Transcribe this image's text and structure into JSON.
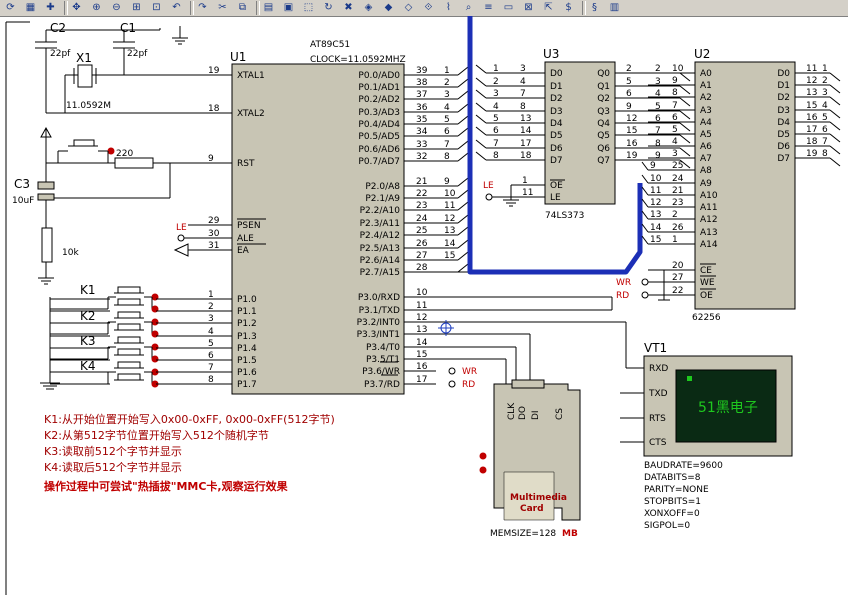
{
  "toolbar": {
    "icons": [
      "refresh-icon",
      "grid-icon",
      "origin-icon",
      "pan-icon",
      "zoom-in-icon",
      "zoom-out-icon",
      "zoom-fit-icon",
      "zoom-area-icon",
      "undo-icon",
      "redo-icon",
      "cut-icon",
      "copy-icon",
      "paste-icon",
      "block-copy-icon",
      "block-move-icon",
      "block-rotate-icon",
      "block-delete-icon",
      "pick-device-icon",
      "make-device-icon",
      "package-icon",
      "decompose-icon",
      "wire-autorouter-icon",
      "search-icon",
      "property-icon",
      "new-sheet-icon",
      "remove-sheet-icon",
      "exit-to-parent-icon",
      "bom-icon",
      "erc-icon",
      "netlist-icon"
    ]
  },
  "components": {
    "c2": {
      "ref": "C2",
      "value": "22pf"
    },
    "c1": {
      "ref": "C1",
      "value": "22pf"
    },
    "x1": {
      "ref": "X1",
      "value": "11.0592M"
    },
    "c3": {
      "ref": "C3",
      "value": "10uF"
    },
    "r_reset_series": {
      "value": "220"
    },
    "r_reset_pulldown": {
      "value": "10k"
    },
    "k1": "K1",
    "k2": "K2",
    "k3": "K3",
    "k4": "K4"
  },
  "u1": {
    "ref": "U1",
    "part": "AT89C51",
    "clock": "CLOCK=11.0592MHZ",
    "left_pins": [
      {
        "num": "19",
        "name": "XTAL1"
      },
      {
        "num": "18",
        "name": "XTAL2"
      },
      {
        "num": "9",
        "name": "RST"
      },
      {
        "num": "29",
        "name": "PSEN"
      },
      {
        "num": "30",
        "name": "ALE"
      },
      {
        "num": "31",
        "name": "EA"
      },
      {
        "num": "1",
        "name": "P1.0"
      },
      {
        "num": "2",
        "name": "P1.1"
      },
      {
        "num": "3",
        "name": "P1.2"
      },
      {
        "num": "4",
        "name": "P1.3"
      },
      {
        "num": "5",
        "name": "P1.4"
      },
      {
        "num": "6",
        "name": "P1.5"
      },
      {
        "num": "7",
        "name": "P1.6"
      },
      {
        "num": "8",
        "name": "P1.7"
      }
    ],
    "right_pins": [
      {
        "num": "39",
        "name": "P0.0/AD0",
        "net": "1"
      },
      {
        "num": "38",
        "name": "P0.1/AD1",
        "net": "2"
      },
      {
        "num": "37",
        "name": "P0.2/AD2",
        "net": "3"
      },
      {
        "num": "36",
        "name": "P0.3/AD3",
        "net": "4"
      },
      {
        "num": "35",
        "name": "P0.4/AD4",
        "net": "5"
      },
      {
        "num": "34",
        "name": "P0.5/AD5",
        "net": "6"
      },
      {
        "num": "33",
        "name": "P0.6/AD6",
        "net": "7"
      },
      {
        "num": "32",
        "name": "P0.7/AD7",
        "net": "8"
      },
      {
        "num": "21",
        "name": "P2.0/A8",
        "net": "9"
      },
      {
        "num": "22",
        "name": "P2.1/A9",
        "net": "10"
      },
      {
        "num": "23",
        "name": "P2.2/A10",
        "net": "11"
      },
      {
        "num": "24",
        "name": "P2.3/A11",
        "net": "12"
      },
      {
        "num": "25",
        "name": "P2.4/A12",
        "net": "13"
      },
      {
        "num": "26",
        "name": "P2.5/A13",
        "net": "14"
      },
      {
        "num": "27",
        "name": "P2.6/A14",
        "net": "15"
      },
      {
        "num": "28",
        "name": "P2.7/A15",
        "net": ""
      },
      {
        "num": "10",
        "name": "P3.0/RXD",
        "net": ""
      },
      {
        "num": "11",
        "name": "P3.1/TXD",
        "net": ""
      },
      {
        "num": "12",
        "name": "P3.2/INT0",
        "net": ""
      },
      {
        "num": "13",
        "name": "P3.3/INT1",
        "net": ""
      },
      {
        "num": "14",
        "name": "P3.4/T0",
        "net": ""
      },
      {
        "num": "15",
        "name": "P3.5/T1",
        "net": ""
      },
      {
        "num": "16",
        "name": "P3.6/WR",
        "net": "WR"
      },
      {
        "num": "17",
        "name": "P3.7/RD",
        "net": "RD"
      }
    ],
    "le_label": "LE"
  },
  "u3": {
    "ref": "U3",
    "part": "74LS373",
    "d_pins": [
      {
        "num": "3",
        "name": "D0"
      },
      {
        "num": "4",
        "name": "D1"
      },
      {
        "num": "7",
        "name": "D2"
      },
      {
        "num": "8",
        "name": "D3"
      },
      {
        "num": "13",
        "name": "D4"
      },
      {
        "num": "14",
        "name": "D5"
      },
      {
        "num": "17",
        "name": "D6"
      },
      {
        "num": "18",
        "name": "D7"
      }
    ],
    "q_pins": [
      {
        "num": "2",
        "name": "Q0"
      },
      {
        "num": "5",
        "name": "Q1"
      },
      {
        "num": "6",
        "name": "Q2"
      },
      {
        "num": "9",
        "name": "Q3"
      },
      {
        "num": "12",
        "name": "Q4"
      },
      {
        "num": "15",
        "name": "Q5"
      },
      {
        "num": "16",
        "name": "Q6"
      },
      {
        "num": "19",
        "name": "Q7"
      }
    ],
    "d_nets": [
      "1",
      "2",
      "3",
      "4",
      "5",
      "6",
      "7",
      "8"
    ],
    "q_nets": [
      "2",
      "3",
      "4",
      "5",
      "6",
      "7",
      "8",
      "9"
    ],
    "oe": {
      "num": "1",
      "name": "OE"
    },
    "le": {
      "num": "11",
      "name": "LE"
    },
    "le_label": "LE"
  },
  "u2": {
    "ref": "U2",
    "part": "62256",
    "a_pins": [
      {
        "num": "10",
        "name": "A0",
        "net": "2"
      },
      {
        "num": "9",
        "name": "A1",
        "net": "3"
      },
      {
        "num": "8",
        "name": "A2",
        "net": "4"
      },
      {
        "num": "7",
        "name": "A3",
        "net": "5"
      },
      {
        "num": "6",
        "name": "A4",
        "net": "6"
      },
      {
        "num": "5",
        "name": "A5",
        "net": "7"
      },
      {
        "num": "4",
        "name": "A6",
        "net": "8"
      },
      {
        "num": "3",
        "name": "A7",
        "net": "9"
      },
      {
        "num": "25",
        "name": "A8",
        "net": "9"
      },
      {
        "num": "24",
        "name": "A9",
        "net": "10"
      },
      {
        "num": "21",
        "name": "A10",
        "net": "11"
      },
      {
        "num": "23",
        "name": "A11",
        "net": "12"
      },
      {
        "num": "2",
        "name": "A12",
        "net": "13"
      },
      {
        "num": "26",
        "name": "A13",
        "net": "14"
      },
      {
        "num": "1",
        "name": "A14",
        "net": "15"
      }
    ],
    "d_pins": [
      {
        "num": "11",
        "name": "D0",
        "net": "1"
      },
      {
        "num": "12",
        "name": "D1",
        "net": "2"
      },
      {
        "num": "13",
        "name": "D2",
        "net": "3"
      },
      {
        "num": "15",
        "name": "D3",
        "net": "4"
      },
      {
        "num": "16",
        "name": "D4",
        "net": "5"
      },
      {
        "num": "17",
        "name": "D5",
        "net": "6"
      },
      {
        "num": "18",
        "name": "D6",
        "net": "7"
      },
      {
        "num": "19",
        "name": "D7",
        "net": "8"
      }
    ],
    "ctrl_pins": [
      {
        "num": "20",
        "name": "CE",
        "net": ""
      },
      {
        "num": "27",
        "name": "WE",
        "net": "WR"
      },
      {
        "num": "22",
        "name": "OE",
        "net": "RD"
      }
    ]
  },
  "vt1": {
    "ref": "VT1",
    "pins": [
      "RXD",
      "TXD",
      "RTS",
      "CTS"
    ],
    "screen_text": "51黑电子",
    "props": [
      "BAUDRATE=9600",
      "DATABITS=8",
      "PARITY=NONE",
      "STOPBITS=1",
      "XONXOFF=0",
      "SIGPOL=0"
    ]
  },
  "mmc": {
    "pins": [
      "CLK",
      "DO",
      "DI",
      "CS"
    ],
    "card_label_1": "Multimedia",
    "card_label_2": "Card",
    "memsize_label": "MEMSIZE=128",
    "memsize_unit": "MB"
  },
  "notes": [
    "K1:从开始位置开始写入0x00-0xFF, 0x00-0xFF(512字节)",
    "K2:从第512字节位置开始写入512个随机字节",
    "K3:读取前512个字节并显示",
    "K4:读取后512个字节并显示"
  ],
  "note_bold": "操作过程中可尝试\"热插拔\"MMC卡,观察运行效果",
  "colors": {
    "chip_fill": "#c8c5b4",
    "bus": "#1c2fb6",
    "label_red": "#c00000",
    "terminal_screen": "#0a2a14",
    "terminal_text": "#1ec81e"
  }
}
